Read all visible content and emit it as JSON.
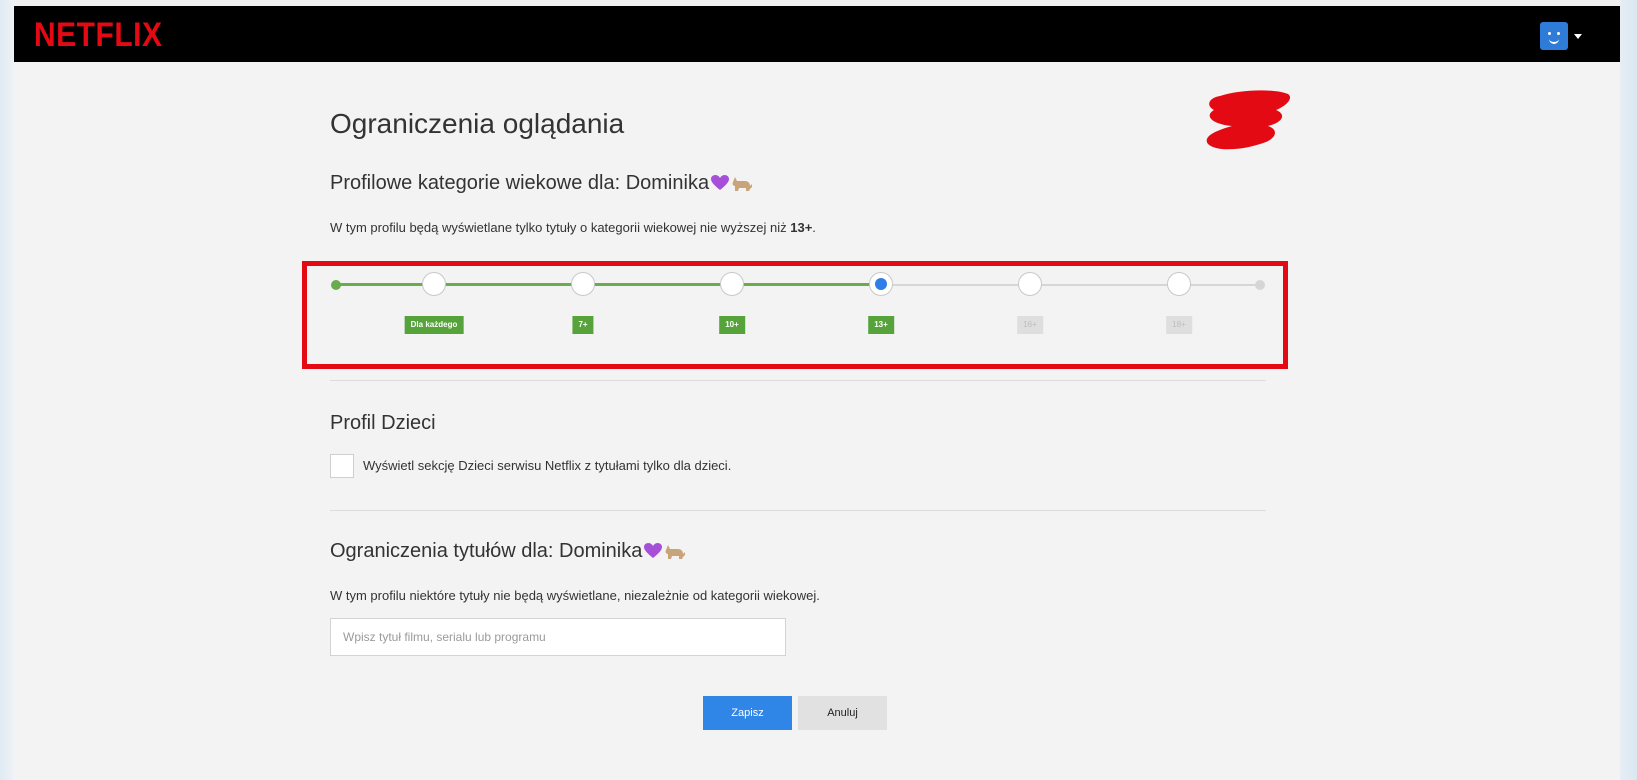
{
  "app": {
    "logo": "NETFLIX"
  },
  "page": {
    "title": "Ograniczenia oglądania"
  },
  "maturity": {
    "heading": "Profilowe kategorie wiekowe dla: Dominika",
    "desc_prefix": "W tym profilu będą wyświetlane tylko tytuły o kategorii wiekowej nie wyższej niż ",
    "desc_value": "13+",
    "desc_suffix": ".",
    "levels": [
      {
        "label": "Dla każdego",
        "active": true
      },
      {
        "label": "7+",
        "active": true
      },
      {
        "label": "10+",
        "active": true
      },
      {
        "label": "13+",
        "active": true
      },
      {
        "label": "16+",
        "active": false
      },
      {
        "label": "18+",
        "active": false
      }
    ],
    "selected_index": 3
  },
  "kids": {
    "heading": "Profil Dzieci",
    "checkbox_label": "Wyświetl sekcję Dzieci serwisu Netflix z tytułami tylko dla dzieci.",
    "checked": false
  },
  "title_restrictions": {
    "heading": "Ograniczenia tytułów dla: Dominika",
    "desc": "W tym profilu niektóre tytuły nie będą wyświetlane, niezależnie od kategorii wiekowej.",
    "input_placeholder": "Wpisz tytuł filmu, serialu lub programu",
    "input_value": ""
  },
  "actions": {
    "save_label": "Zapisz",
    "cancel_label": "Anuluj"
  },
  "colors": {
    "brand": "#e50914",
    "track_active": "#6aab4e",
    "label_active": "#56a33b",
    "selected_knob": "#2e7de9",
    "save_button": "#2f86e6",
    "highlight_box": "#e40a14"
  }
}
